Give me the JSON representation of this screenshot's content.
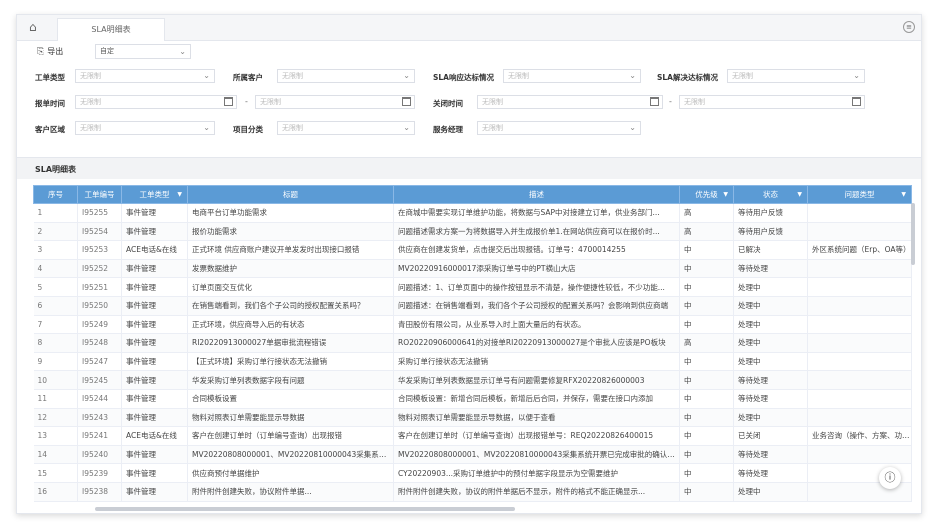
{
  "tabs": {
    "active": "SLA明细表"
  },
  "toolbar": {
    "export_label": "导出",
    "view_select": "自定"
  },
  "filters": {
    "ticket_type": {
      "label": "工单类型",
      "placeholder": "无限制"
    },
    "customer": {
      "label": "所属客户",
      "placeholder": "无限制"
    },
    "sla_response": {
      "label": "SLA响应达标情况",
      "placeholder": "无限制"
    },
    "sla_resolve": {
      "label": "SLA解决达标情况",
      "placeholder": "无限制"
    },
    "report_time": {
      "label": "报单时间",
      "start": "无限制",
      "end": "无限制"
    },
    "close_time": {
      "label": "关闭时间",
      "start": "无限制",
      "end": "无限制"
    },
    "region": {
      "label": "客户区域",
      "placeholder": "无限制"
    },
    "category": {
      "label": "项目分类",
      "placeholder": "无限制"
    },
    "manager": {
      "label": "服务经理",
      "placeholder": "无限制"
    }
  },
  "section": {
    "title": "SLA明细表"
  },
  "table": {
    "headers": [
      "序号",
      "工单编号",
      "工单类型",
      "标题",
      "描述",
      "优先级",
      "状态",
      "问题类型"
    ],
    "rows": [
      [
        "1",
        "I95255",
        "事件管理",
        "电商平台订单功能需求",
        "在商城中需要实现订单维护功能，将数据与SAP中对接建立订单，供业务部门...",
        "高",
        "等待用户反馈",
        ""
      ],
      [
        "2",
        "I95254",
        "事件管理",
        "报价功能需求",
        "问题描述需求方案一为将数据导入并生成报价单1.在网站供应商可以在报价时...",
        "高",
        "等待用户反馈",
        ""
      ],
      [
        "3",
        "I95253",
        "ACE电话&在线",
        "正式环境 供应商账户建议开单发发时出现接口报错",
        "供应商在创建发货单，点击提交后出现报错。订单号：4700014255",
        "中",
        "已解决",
        "外区系统问题（Erp、OA等）"
      ],
      [
        "4",
        "I95252",
        "事件管理",
        "发票数据维护",
        "MV20220916000017添采购订单号中的PT横山大店",
        "中",
        "等待处理",
        ""
      ],
      [
        "5",
        "I95251",
        "事件管理",
        "订单页面交互优化",
        "问题描述：1、订单页面中的操作按钮显示不清楚，操作便捷性较低，不少功能...",
        "中",
        "处理中",
        ""
      ],
      [
        "6",
        "I95250",
        "事件管理",
        "在销售端看到，我们各个子公司的授权配置关系吗？",
        "问题描述：在销售端看到，我们各个子公司授权的配置关系吗？会影响到供应商端",
        "中",
        "处理中",
        ""
      ],
      [
        "7",
        "I95249",
        "事件管理",
        "正式环境，供应商导入后的有状态",
        "青田股份有限公司，从业系导入时上面大量后的有状态。",
        "中",
        "处理中",
        ""
      ],
      [
        "8",
        "I95248",
        "事件管理",
        "RI20220913000027单据审批流程错误",
        "RO20220906000641的对接单RI20220913000027是个审批人应该是PO板块",
        "高",
        "处理中",
        ""
      ],
      [
        "9",
        "I95247",
        "事件管理",
        "【正式环境】采购订单行接状态无法撤销",
        "采购订单行接状态无法撤销",
        "中",
        "处理中",
        ""
      ],
      [
        "10",
        "I95245",
        "事件管理",
        "华发采购订单列表数据字段有问题",
        "华发采购订单列表数据显示订单号有问题需要修复RFX20220826000003",
        "中",
        "等待处理",
        ""
      ],
      [
        "11",
        "I95244",
        "事件管理",
        "合同模板设置",
        "合同模板设置：新增合同后模板，新增后后合同，并保存，需要在接口内添加",
        "中",
        "等待处理",
        ""
      ],
      [
        "12",
        "I95243",
        "事件管理",
        "物料对照表订单需要能显示导数据",
        "物料对照表订单需要能显示导数据，以便于查看",
        "中",
        "处理中",
        ""
      ],
      [
        "13",
        "I95241",
        "ACE电话&在线",
        "客户在创建订单时（订单编号查询）出现报错",
        "客户在创建订单时（订单编号查询）出现报错单号：REQ20220826400015",
        "中",
        "已关闭",
        "业务咨询（操作、方案、功能）"
      ],
      [
        "14",
        "I95240",
        "事件管理",
        "MV20220808000001、MV20220810000043采集系统开票",
        "MV20220808000001、MV20220810000043采集系统开票已完成审批的确认提交",
        "中",
        "等待处理",
        ""
      ],
      [
        "15",
        "I95239",
        "事件管理",
        "供应商预付单据维护",
        "CY20220903...采购订单维护中的预付单据字段显示为空需要维护",
        "中",
        "等待处理",
        ""
      ],
      [
        "16",
        "I95238",
        "事件管理",
        "附件附件创建失败，协议附件单据...",
        "附件附件创建失败，协议的附件单据后不显示，附件的格式不能正确显示...",
        "中",
        "处理中",
        ""
      ]
    ]
  }
}
